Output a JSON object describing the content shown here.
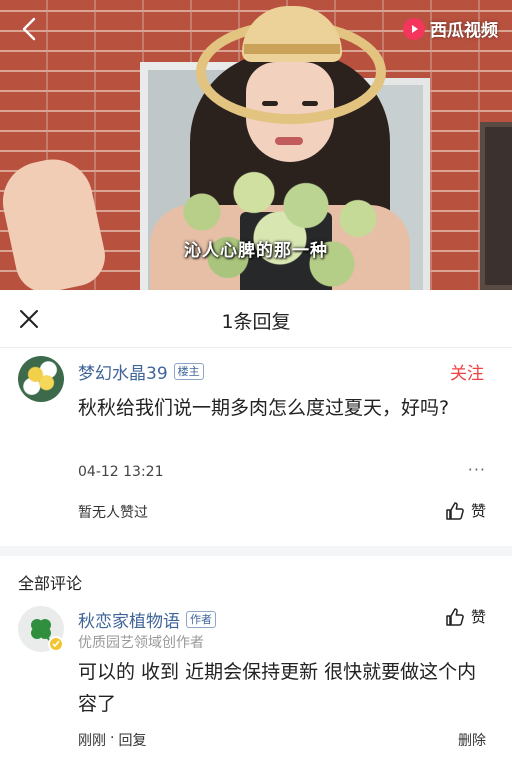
{
  "video": {
    "caption": "沁人心脾的那一种",
    "brand": "西瓜视频",
    "icons": [
      "back-arrow-icon",
      "xigua-logo-icon"
    ]
  },
  "reply_header": {
    "title": "1条回复",
    "close_icon": "close-icon"
  },
  "main_comment": {
    "user_name": "梦幻水晶39",
    "tag": "楼主",
    "follow_label": "关注",
    "text": "秋秋给我们说一期多肉怎么度过夏天，好吗?",
    "time": "04-12 13:21",
    "more_label": "···",
    "likes_text": "暂无人赞过",
    "like_label": "赞"
  },
  "all_comments": {
    "title": "全部评论",
    "items": [
      {
        "user_name": "秋恋家植物语",
        "tag": "作者",
        "desc": "优质园艺领域创作者",
        "text": "可以的 收到 近期会保持更新 很快就要做这个内容了",
        "time": "刚刚",
        "separator": "·",
        "reply_label": "回复",
        "like_label": "赞",
        "delete_label": "删除"
      }
    ]
  },
  "colors": {
    "link_blue": "#406599",
    "accent_red": "#f04142",
    "muted_gray": "#999999",
    "brand_red": "#f5365c"
  }
}
